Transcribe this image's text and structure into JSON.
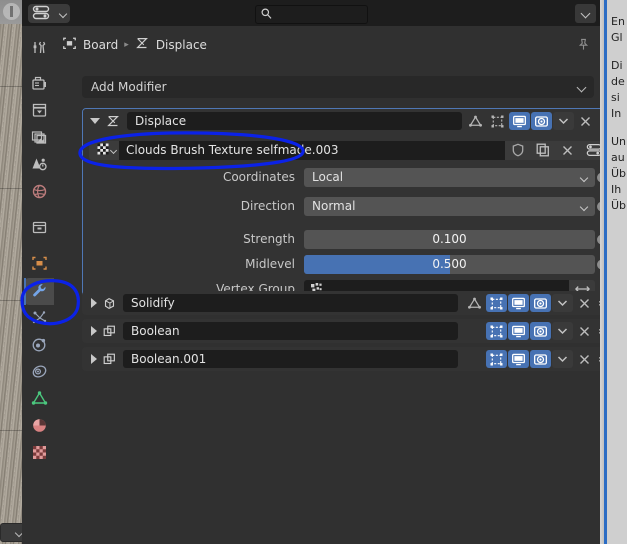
{
  "app": {
    "editor": "Properties",
    "theme_accent": "#4772b3",
    "background": "#303030"
  },
  "topbar": {
    "editor_type_icon": "properties-editor-icon",
    "search_placeholder": "",
    "search_value": "",
    "search_icon": "search-icon",
    "options_chevron": "chevron-down-icon"
  },
  "tabs": [
    {
      "name": "tool",
      "icon": "tool-icon",
      "active": false
    },
    {
      "name": "render",
      "icon": "camera-back-icon",
      "active": false
    },
    {
      "name": "output",
      "icon": "printer-icon",
      "active": false
    },
    {
      "name": "view-layer",
      "icon": "images-icon",
      "active": false
    },
    {
      "name": "scene",
      "icon": "cone-droplet-icon",
      "active": false
    },
    {
      "name": "world",
      "icon": "world-icon",
      "active": false
    },
    {
      "name": "collection",
      "icon": "box-icon",
      "active": false
    },
    {
      "name": "object",
      "icon": "object-square-icon",
      "active": false
    },
    {
      "name": "modifier",
      "icon": "wrench-icon",
      "active": true
    },
    {
      "name": "particles",
      "icon": "particles-icon",
      "active": false
    },
    {
      "name": "physics",
      "icon": "physics-orbit-icon",
      "active": false
    },
    {
      "name": "constraints",
      "icon": "constraint-icon",
      "active": false
    },
    {
      "name": "data",
      "icon": "mesh-data-icon",
      "active": false
    },
    {
      "name": "material",
      "icon": "material-sphere-icon",
      "active": false
    },
    {
      "name": "texture",
      "icon": "checker-texture-icon",
      "active": false
    }
  ],
  "breadcrumb": {
    "object_icon": "object-icon",
    "object": "Board",
    "separator": "▸",
    "modifier_icon": "displace-modifier-icon",
    "modifier": "Displace",
    "pin_icon": "pin-icon"
  },
  "add_modifier": {
    "label": "Add Modifier",
    "chevron": "chevron-down-icon"
  },
  "modifier_stack": [
    {
      "name": "Displace",
      "icon": "displace-modifier-icon",
      "expanded": true,
      "selected": true,
      "header_toggles": [
        {
          "name": "edit-mode-display",
          "icon": "triangle-edit-icon",
          "state": "off"
        },
        {
          "name": "on-cage-display",
          "icon": "cage-icon",
          "state": "off"
        },
        {
          "name": "realtime-display",
          "icon": "monitor-icon",
          "state": "on"
        },
        {
          "name": "render-display",
          "icon": "camera-icon",
          "state": "on"
        }
      ],
      "extras_chevron": "chevron-down-icon",
      "close_icon": "close-x-icon",
      "drag_handle": "drag-dots-icon"
    },
    {
      "name": "Solidify",
      "icon": "solidify-modifier-icon",
      "expanded": false,
      "selected": false,
      "header_toggles": [
        {
          "name": "edit-mode-display",
          "icon": "triangle-edit-icon",
          "state": "off"
        },
        {
          "name": "on-cage-display",
          "icon": "cage-icon",
          "state": "on"
        },
        {
          "name": "realtime-display",
          "icon": "monitor-icon",
          "state": "on"
        },
        {
          "name": "render-display",
          "icon": "camera-icon",
          "state": "on"
        }
      ],
      "extras_chevron": "chevron-down-icon",
      "close_icon": "close-x-icon",
      "drag_handle": "drag-dots-icon"
    },
    {
      "name": "Boolean",
      "icon": "boolean-modifier-icon",
      "expanded": false,
      "selected": false,
      "header_toggles": [
        {
          "name": "on-cage-display",
          "icon": "cage-icon",
          "state": "on"
        },
        {
          "name": "realtime-display",
          "icon": "monitor-icon",
          "state": "on"
        },
        {
          "name": "render-display",
          "icon": "camera-icon",
          "state": "on"
        }
      ],
      "extras_chevron": "chevron-down-icon",
      "close_icon": "close-x-icon",
      "drag_handle": "drag-dots-icon"
    },
    {
      "name": "Boolean.001",
      "icon": "boolean-modifier-icon",
      "expanded": false,
      "selected": false,
      "header_toggles": [
        {
          "name": "on-cage-display",
          "icon": "cage-icon",
          "state": "on"
        },
        {
          "name": "realtime-display",
          "icon": "monitor-icon",
          "state": "on"
        },
        {
          "name": "render-display",
          "icon": "camera-icon",
          "state": "on"
        }
      ],
      "extras_chevron": "chevron-down-icon",
      "close_icon": "close-x-icon",
      "drag_handle": "drag-dots-icon"
    }
  ],
  "displace_panel": {
    "texture": {
      "browse_icon": "texture-browse-icon",
      "value": "Clouds Brush Texture selfmade.003",
      "fake_user_icon": "shield-icon",
      "new_icon": "copy-icon",
      "unlink_icon": "close-x-icon",
      "show_texture_icon": "properties-editor-icon"
    },
    "fields": [
      {
        "label": "Coordinates",
        "type": "dropdown",
        "value": "Local",
        "animatable": true
      },
      {
        "label": "Direction",
        "type": "dropdown",
        "value": "Normal",
        "animatable": true
      },
      {
        "label": "Strength",
        "type": "slider",
        "value": "0.100",
        "fill_pct": 0,
        "animatable": true
      },
      {
        "label": "Midlevel",
        "type": "slider",
        "value": "0.500",
        "fill_pct": 50,
        "animatable": true
      }
    ],
    "vertex_group": {
      "label": "Vertex Group",
      "icon": "vertex-group-icon",
      "value": "",
      "invert_icon": "invert-arrows-icon"
    }
  },
  "viewport_sliver": {
    "name": "3d-viewport-edge",
    "dropdown_icon": "chevron-down-icon"
  },
  "document_sliver": {
    "lines": [
      "En",
      "Gl",
      "Di",
      "de",
      "si",
      "In",
      "Un",
      "au",
      "Üb",
      "Ih",
      "Üb"
    ]
  },
  "annotations": {
    "color": "#0b22e8",
    "shapes": [
      "ellipse-around-texture-field",
      "ellipse-around-modifier-tab"
    ]
  }
}
